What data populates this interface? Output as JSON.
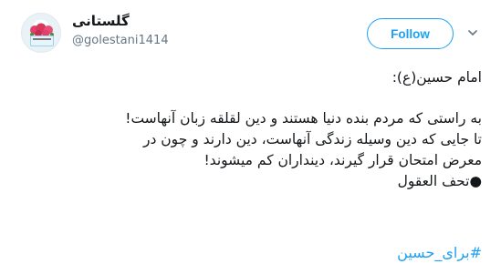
{
  "author": {
    "name": "گلستانی",
    "handle": "@golestani1414"
  },
  "follow_label": "Follow",
  "tweet": {
    "lines_block1": [
      "امام حسین(ع):"
    ],
    "lines_block2": [
      "به راستی که مردم بنده دنیا هستند و دین لقلقه زبان آنهاست!",
      "تا جایی که دین وسیله زندگی آنهاست، دین دارند و چون در",
      "معرض امتحان قرار گیرند، دینداران کم میشوند!",
      "●تحف العقول"
    ],
    "hashtag": "#برای_حسین"
  },
  "colors": {
    "accent": "#1da1f2",
    "text": "#14171a",
    "muted": "#657786"
  }
}
